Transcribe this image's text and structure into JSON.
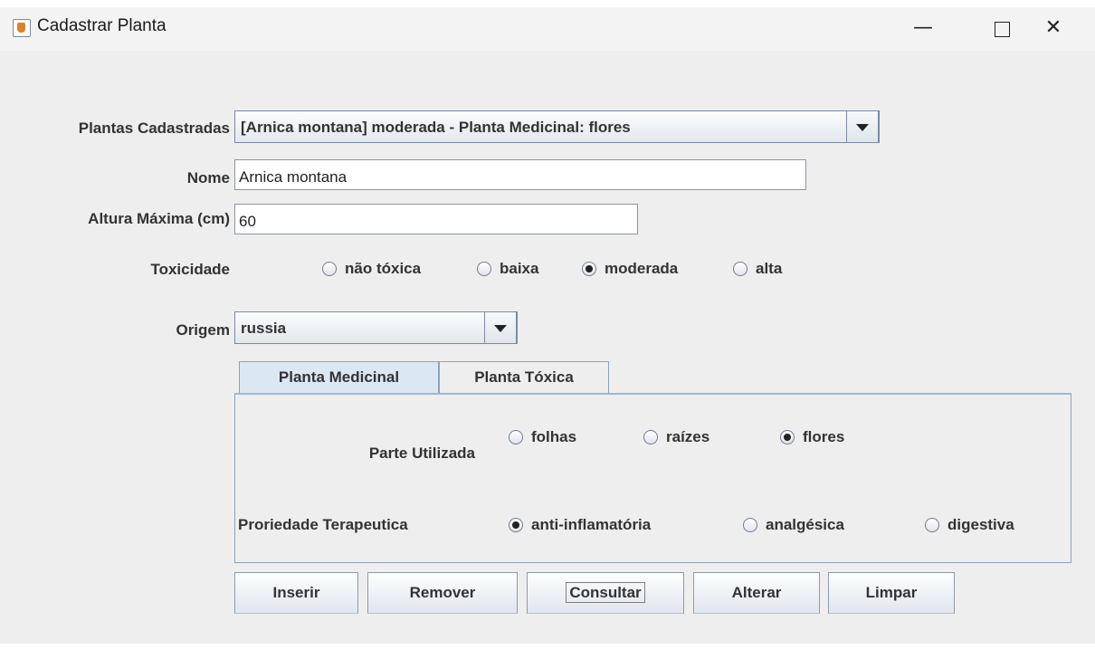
{
  "window": {
    "title": "Cadastrar Planta",
    "minimize_glyph": "—",
    "close_glyph": "✕"
  },
  "form": {
    "plantas_label": "Plantas Cadastradas",
    "plantas_selected": "[Arnica montana] moderada - Planta Medicinal: flores",
    "nome_label": "Nome",
    "nome_value": "Arnica montana",
    "altura_label": "Altura Máxima (cm)",
    "altura_value": "60",
    "toxicidade_label": "Toxicidade",
    "toxicidade_options": [
      {
        "label": "não tóxica",
        "selected": false
      },
      {
        "label": "baixa",
        "selected": false
      },
      {
        "label": "moderada",
        "selected": true
      },
      {
        "label": "alta",
        "selected": false
      }
    ],
    "origem_label": "Origem",
    "origem_selected": "russia"
  },
  "tabs": [
    {
      "label": "Planta Medicinal",
      "active": true
    },
    {
      "label": "Planta Tóxica",
      "active": false
    }
  ],
  "medicinal": {
    "parte_label": "Parte Utilizada",
    "parte_options": [
      {
        "label": "folhas",
        "selected": false
      },
      {
        "label": "raízes",
        "selected": false
      },
      {
        "label": "flores",
        "selected": true
      }
    ],
    "propriedade_label": "Proriedade Terapeutica",
    "propriedade_options": [
      {
        "label": "anti-inflamatória",
        "selected": true
      },
      {
        "label": "analgésica",
        "selected": false
      },
      {
        "label": "digestiva",
        "selected": false
      }
    ]
  },
  "buttons": {
    "inserir": "Inserir",
    "remover": "Remover",
    "consultar": "Consultar",
    "alterar": "Alterar",
    "limpar": "Limpar"
  }
}
